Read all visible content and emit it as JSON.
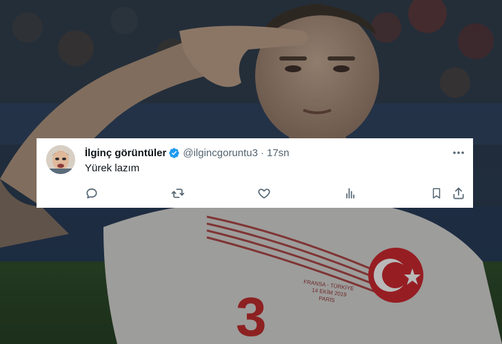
{
  "tweet": {
    "display_name": "İlginç görüntüler",
    "handle": "@ilgincgoruntu3",
    "separator": "·",
    "timestamp": "17sn",
    "text": "Yürek lazım",
    "verified": true
  },
  "icons": {
    "verified": "verified-badge-icon",
    "more": "more-options-icon",
    "reply": "reply-icon",
    "retweet": "retweet-icon",
    "like": "heart-icon",
    "views": "views-icon",
    "bookmark": "bookmark-icon",
    "share": "share-icon"
  },
  "colors": {
    "verified": "#1d9bf0",
    "icon": "#536471",
    "text": "#0f1419"
  },
  "background": {
    "jersey_number": "3",
    "jersey_text_1": "FRANSA - TÜRKİYE",
    "jersey_text_2": "14 EKİM 2019",
    "jersey_text_3": "PARİS"
  }
}
